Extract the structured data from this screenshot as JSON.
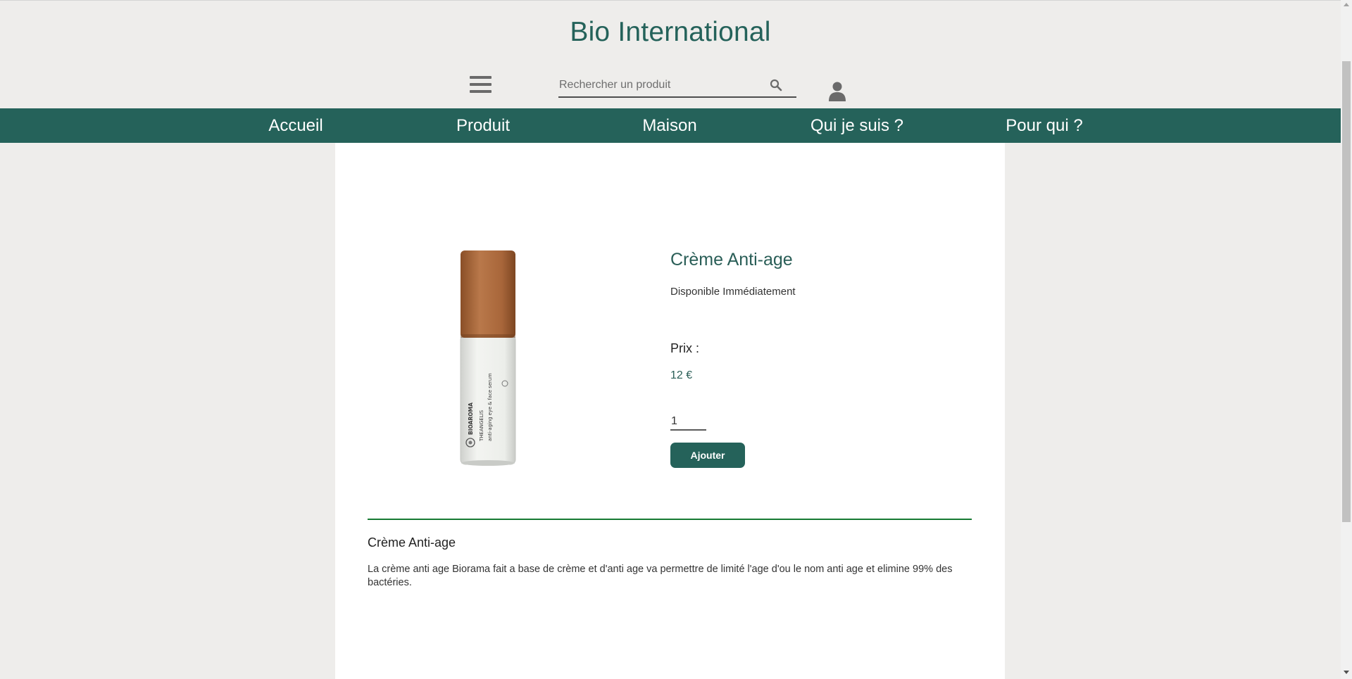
{
  "header": {
    "brand": "Bio International",
    "search_placeholder": "Rechercher un produit",
    "search_value": ""
  },
  "icons": {
    "menu": "hamburger-menu-icon",
    "search": "search-icon",
    "account": "user-icon",
    "product": "product-bottle-image"
  },
  "nav": {
    "items": [
      {
        "label": "Accueil"
      },
      {
        "label": "Produit"
      },
      {
        "label": "Maison"
      },
      {
        "label": "Qui je suis ?"
      },
      {
        "label": "Pour qui ?"
      }
    ]
  },
  "product": {
    "title": "Crème Anti-age",
    "availability": "Disponible Immédiatement",
    "price_label": "Prix :",
    "price": "12 €",
    "quantity": "1",
    "add_button": "Ajouter",
    "image_text": {
      "brand": "BIOAROMA",
      "line": "THEANGELIS",
      "product": "anti-aging eye & face serum"
    }
  },
  "description": {
    "title": "Crème Anti-age",
    "text": "La crème anti age Biorama fait a base de crème et d'anti age va permettre de limité l'age d'ou le nom anti age et elimine 99% des bactéries."
  },
  "colors": {
    "brand": "#24625a",
    "navbar": "#25625a",
    "divider": "#177a33",
    "page_background": "#eeedeb",
    "content_background": "#ffffff"
  }
}
